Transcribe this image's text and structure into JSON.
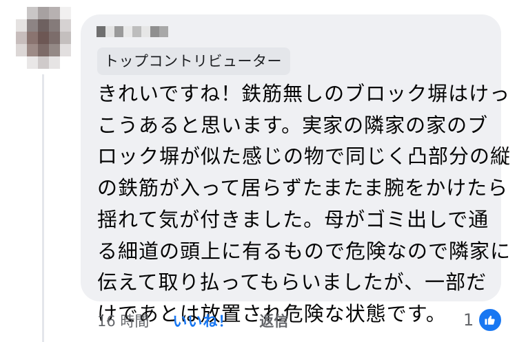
{
  "comment": {
    "badge": "トップコントリビューター",
    "text": "きれいですね！鉄筋無しのブロック塀はけっ\nこうあると思います。実家の隣家の家のブ\nロック塀が似た感じの物で同じく凸部分の縦\nの鉄筋が入って居らずたまたま腕をかけたら\n揺れて気が付きました。母がゴミ出しで通\nる細道の頭上に有るもので危険なので隣家に\n伝えて取り払ってもらいましたが、一部だ\nけであとは放置され危険な状態です。"
  },
  "actions": {
    "time": "16 時間",
    "like_label": "いいね！",
    "reply_label": "返信"
  },
  "reactions": {
    "count": "1",
    "icon": "thumbs-up-icon"
  },
  "colors": {
    "bubble": "#eff0f3",
    "accent": "#1877f2",
    "muted": "#65676b"
  }
}
